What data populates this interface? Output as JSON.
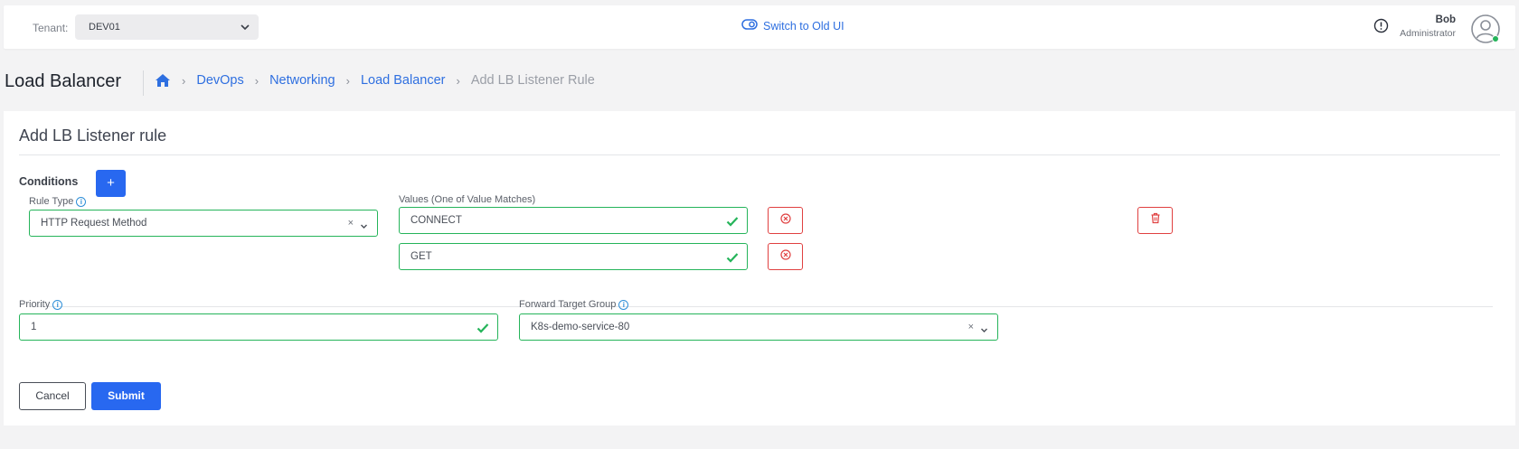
{
  "topbar": {
    "tenant_label": "Tenant:",
    "tenant_value": "DEV01",
    "switch_ui_label": "Switch to Old UI",
    "user_name": "Bob",
    "user_role": "Administrator"
  },
  "header": {
    "title": "Load Balancer",
    "breadcrumb": [
      "DevOps",
      "Networking",
      "Load Balancer"
    ],
    "breadcrumb_current": "Add LB Listener Rule"
  },
  "form": {
    "title": "Add LB Listener rule",
    "conditions_label": "Conditions",
    "add_label": "+",
    "rule_type_label": "Rule Type",
    "rule_type_value": "HTTP Request Method",
    "values_label": "Values (One of Value Matches)",
    "values": [
      "CONNECT",
      "GET"
    ],
    "priority_label": "Priority",
    "priority_value": "1",
    "forward_target_label": "Forward Target Group",
    "forward_target_value": "K8s-demo-service-80",
    "clear_symbol": "×",
    "cancel_label": "Cancel",
    "submit_label": "Submit"
  },
  "colors": {
    "accent": "#2868f0",
    "valid": "#25b45a",
    "danger": "#e04040",
    "link": "#2e6fe0"
  },
  "icons": [
    "chevron-down-icon",
    "toggle-icon",
    "alert-circle-icon",
    "user-avatar-icon",
    "home-icon",
    "info-icon",
    "check-icon",
    "clear-icon",
    "remove-value-icon",
    "trash-icon"
  ]
}
